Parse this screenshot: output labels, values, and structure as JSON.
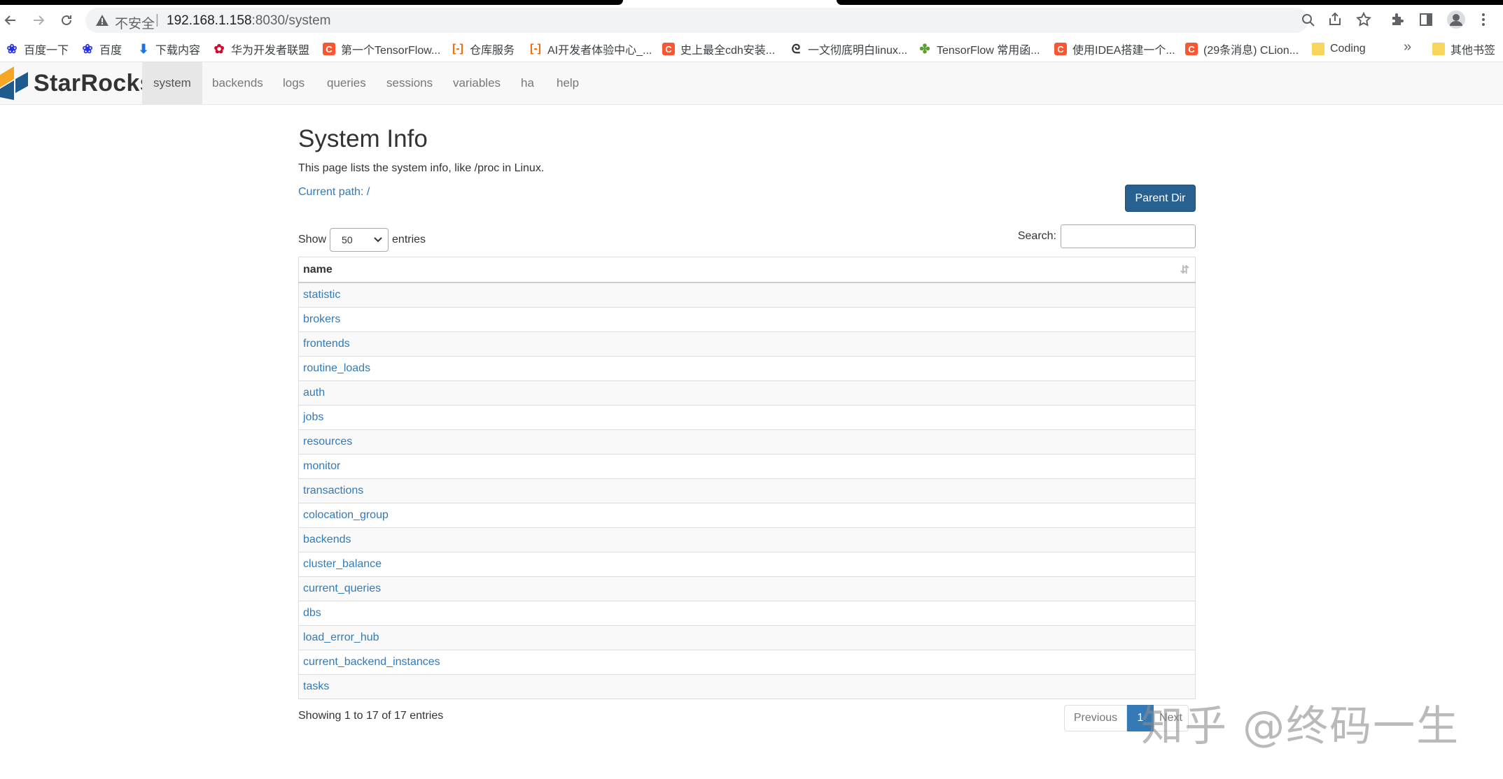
{
  "browser": {
    "insecure_label": "不安全",
    "url_host": "192.168.1.158",
    "url_rest": ":8030/system"
  },
  "bookmarks": [
    {
      "label": "百度一下",
      "icon": "baidu-paw-icon"
    },
    {
      "label": "百度",
      "icon": "baidu-paw-icon"
    },
    {
      "label": "下载内容",
      "icon": "download-icon"
    },
    {
      "label": "华为开发者联盟",
      "icon": "huawei-icon"
    },
    {
      "label": "第一个TensorFlow...",
      "icon": "csdn-icon",
      "glyph": "C"
    },
    {
      "label": "仓库服务",
      "icon": "aliyun-icon"
    },
    {
      "label": "AI开发者体验中心_...",
      "icon": "aliyun-icon"
    },
    {
      "label": "史上最全cdh安装...",
      "icon": "csdn-icon",
      "glyph": "C"
    },
    {
      "label": "一文彻底明白linux...",
      "icon": "zhihu-icon"
    },
    {
      "label": "TensorFlow 常用函...",
      "icon": "tf-icon"
    },
    {
      "label": "使用IDEA搭建一个...",
      "icon": "csdn-icon",
      "glyph": "C"
    },
    {
      "label": "(29条消息) CLion...",
      "icon": "csdn-icon",
      "glyph": "C"
    },
    {
      "label": "Coding",
      "icon": "folder-icon"
    },
    {
      "label": "其他书签",
      "icon": "folder-icon"
    }
  ],
  "bookmarks_more": "»",
  "app": {
    "brand": "StarRocks",
    "tabs": [
      "system",
      "backends",
      "logs",
      "queries",
      "sessions",
      "variables",
      "ha",
      "help"
    ],
    "active_tab": "system"
  },
  "page": {
    "title": "System Info",
    "description": "This page lists the system info, like /proc in Linux.",
    "current_path": "Current path: /",
    "parent_dir_label": "Parent Dir",
    "show_label": "Show",
    "entries_label": "entries",
    "show_value": "50",
    "search_label": "Search:",
    "search_value": "",
    "column_header": "name",
    "rows": [
      "statistic",
      "brokers",
      "frontends",
      "routine_loads",
      "auth",
      "jobs",
      "resources",
      "monitor",
      "transactions",
      "colocation_group",
      "backends",
      "cluster_balance",
      "current_queries",
      "dbs",
      "load_error_hub",
      "current_backend_instances",
      "tasks"
    ],
    "info": "Showing 1 to 17 of 17 entries",
    "pager": {
      "previous": "Previous",
      "current": "1",
      "next": "Next"
    }
  },
  "watermark": "知乎 @终码一生",
  "colors": {
    "link": "#337ab7",
    "primary_button": "#286090",
    "brand_orange": "#f5a623",
    "brand_blue": "#1f5b8f"
  }
}
